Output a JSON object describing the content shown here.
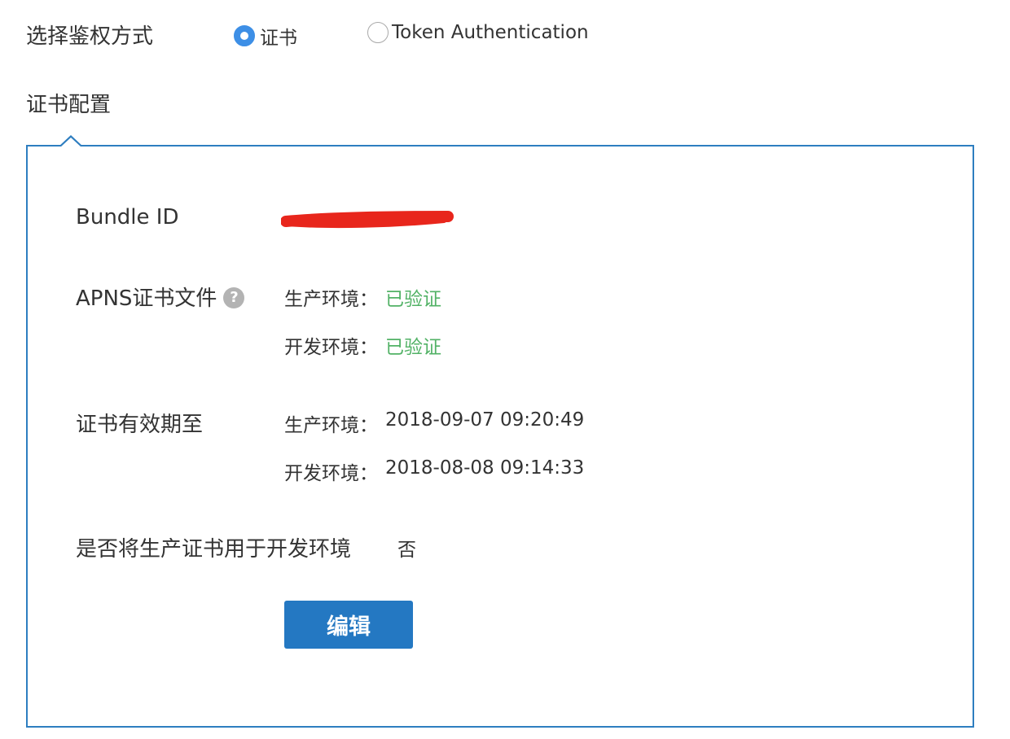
{
  "auth": {
    "label": "选择鉴权方式",
    "options": [
      {
        "label": "证书",
        "checked": true
      },
      {
        "label": "Token Authentication",
        "checked": false
      }
    ]
  },
  "section_title": "证书配置",
  "bundle": {
    "label": "Bundle ID",
    "value": ""
  },
  "apns": {
    "label": "APNS证书文件",
    "help_glyph": "?",
    "prod_key": "生产环境：",
    "prod_value": "已验证",
    "dev_key": "开发环境：",
    "dev_value": "已验证"
  },
  "expiry": {
    "label": "证书有效期至",
    "prod_key": "生产环境：",
    "prod_value": "2018-09-07 09:20:49",
    "dev_key": "开发环境：",
    "dev_value": "2018-08-08 09:14:33"
  },
  "use_prod_for_dev": {
    "label": "是否将生产证书用于开发环境",
    "value": "否"
  },
  "edit_button": "编辑",
  "colors": {
    "accent": "#3d8fe6",
    "panel_border": "#2e7ec0",
    "button": "#2478c2",
    "verified": "#52b266",
    "redaction": "#e8261c"
  }
}
